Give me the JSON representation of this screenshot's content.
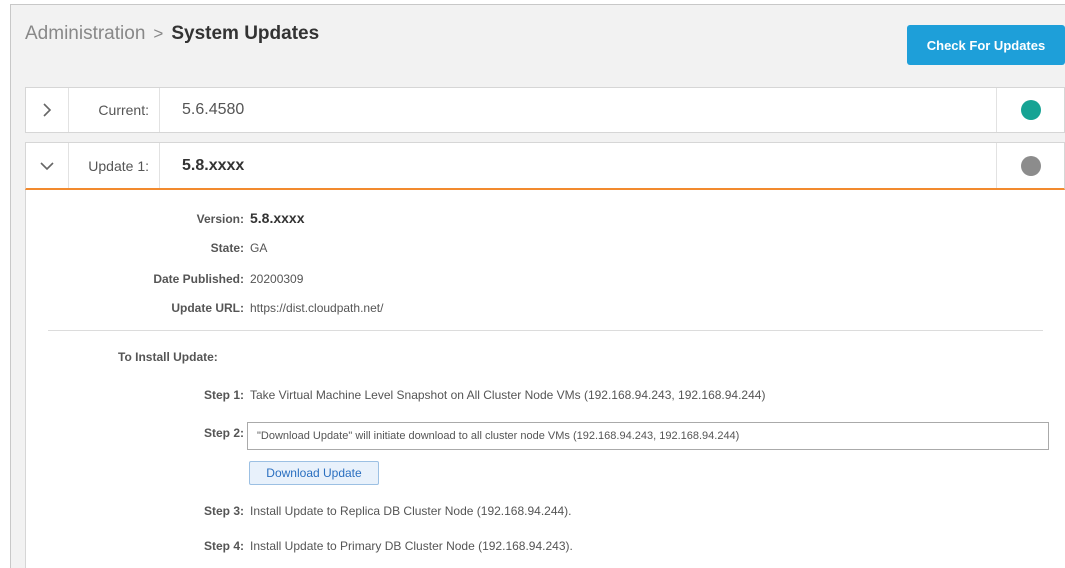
{
  "breadcrumb": {
    "root": "Administration",
    "separator": ">",
    "current": "System Updates"
  },
  "header": {
    "check_button": "Check For Updates"
  },
  "current_row": {
    "label": "Current:",
    "value": "5.6.4580",
    "status_color": "#16a394",
    "chevron": "chevron-right-icon"
  },
  "update_row": {
    "label": "Update 1:",
    "value": "5.8.xxxx",
    "status_color": "#8c8c8c",
    "chevron": "chevron-down-icon",
    "accent_color": "#f28a2e"
  },
  "details": {
    "version_label": "Version:",
    "version_value": "5.8.xxxx",
    "state_label": "State:",
    "state_value": "GA",
    "date_label": "Date Published:",
    "date_value": "20200309",
    "url_label": "Update URL:",
    "url_value": "https://dist.cloudpath.net/"
  },
  "install": {
    "title": "To Install Update:",
    "step1_label": "Step 1:",
    "step1_text": "Take Virtual Machine Level Snapshot on All Cluster Node VMs (192.168.94.243, 192.168.94.244)",
    "step2_label": "Step 2:",
    "step2_text": "\"Download Update\" will initiate download to all cluster node VMs (192.168.94.243, 192.168.94.244)",
    "download_button": "Download Update",
    "step3_label": "Step 3:",
    "step3_text": "Install Update to Replica DB Cluster Node (192.168.94.244).",
    "step4_label": "Step 4:",
    "step4_text": "Install Update to Primary DB Cluster Node (192.168.94.243)."
  },
  "colors": {
    "primary_button": "#1e9fd9",
    "current_status": "#16a394",
    "update_status": "#8c8c8c"
  }
}
